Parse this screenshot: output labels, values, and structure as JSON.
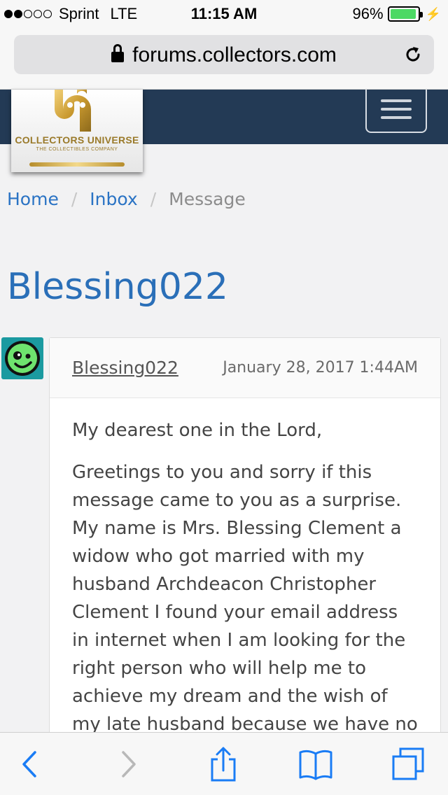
{
  "status_bar": {
    "signal_dots_on": 2,
    "signal_dots_total": 5,
    "carrier": "Sprint",
    "network": "LTE",
    "time": "11:15 AM",
    "battery_text": "96%",
    "battery_level": 0.96,
    "battery_color": "#4cd964"
  },
  "browser": {
    "url": "forums.collectors.com",
    "lock_icon": "lock-icon",
    "reload_icon": "reload-icon"
  },
  "site": {
    "logo_title": "COLLECTORS UNIVERSE",
    "logo_subtitle": "THE COLLECTIBLES COMPANY",
    "header_color": "#233a55",
    "menu_icon": "hamburger-menu-icon"
  },
  "breadcrumb": {
    "items": [
      "Home",
      "Inbox"
    ],
    "separator": "/",
    "current": "Message"
  },
  "page": {
    "title": "Blessing022"
  },
  "message": {
    "author": "Blessing022",
    "date": "January 28, 2017 1:44AM",
    "paragraphs": [
      "My dearest one in the Lord,",
      "Greetings to you and sorry if this message came to you as a surprise. My name is Mrs. Blessing Clement a widow who got married with my husband Archdeacon Christopher Clement I found your email address in internet when I am looking for the right person who will help me to achieve my dream and the wish of my late husband because we have no"
    ]
  },
  "toolbar": {
    "back_icon": "back-chevron-icon",
    "forward_icon": "forward-chevron-icon",
    "share_icon": "share-icon",
    "bookmarks_icon": "bookmarks-book-icon",
    "tabs_icon": "tabs-icon",
    "accent": "#1a7cf5"
  }
}
